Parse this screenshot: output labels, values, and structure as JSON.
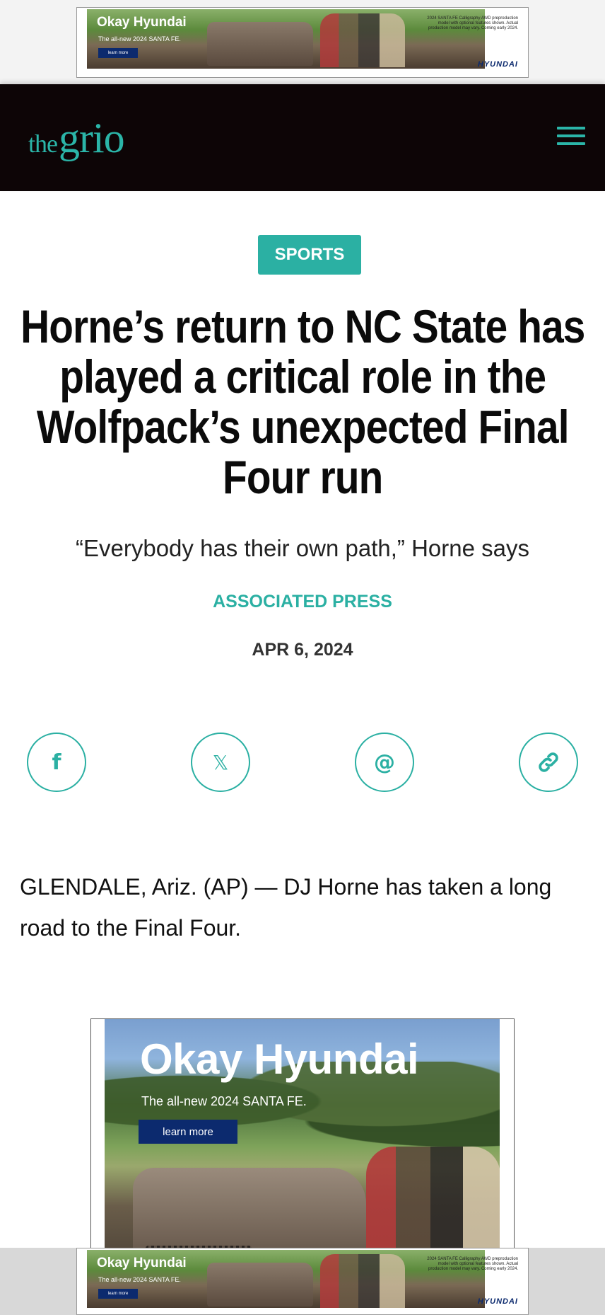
{
  "top_ad": {
    "brand": "Okay Hyundai",
    "tagline": "The all-new 2024 SANTA FE.",
    "cta": "learn more",
    "disclaimer": "2024 SANTA FE Calligraphy AWD preproduction model with optional features shown. Actual production model may vary. Coming early 2024.",
    "logo_text": "HYUNDAI"
  },
  "site": {
    "logo_the": "the",
    "logo_grio": "grio",
    "menu_icon": "hamburger-icon",
    "accent_color": "#2bb0a3",
    "header_bg": "#0d0506"
  },
  "article": {
    "category": "SPORTS",
    "headline": "Horne’s return to NC State has played a critical role in the Wolfpack’s unexpected Final Four run",
    "subhead": "“Everybody has their own path,” Horne says",
    "author": "ASSOCIATED PRESS",
    "date": "APR 6, 2024",
    "body": "GLENDALE, Ariz. (AP) — DJ Horne has taken a long road to the Final Four."
  },
  "share": [
    {
      "name": "facebook-icon",
      "glyph": "f"
    },
    {
      "name": "x-icon",
      "glyph": "𝕏"
    },
    {
      "name": "email-icon",
      "glyph": "@"
    },
    {
      "name": "link-icon",
      "glyph": "🔗"
    }
  ],
  "mid_ad": {
    "brand": "Okay Hyundai",
    "tagline": "The all-new 2024 SANTA FE.",
    "cta": "learn more"
  },
  "sticky_ad": {
    "brand": "Okay Hyundai",
    "tagline": "The all-new 2024 SANTA FE.",
    "cta": "learn more",
    "disclaimer": "2024 SANTA FE Calligraphy AWD preproduction model with optional features shown. Actual production model may vary. Coming early 2024.",
    "logo_text": "HYUNDAI"
  }
}
